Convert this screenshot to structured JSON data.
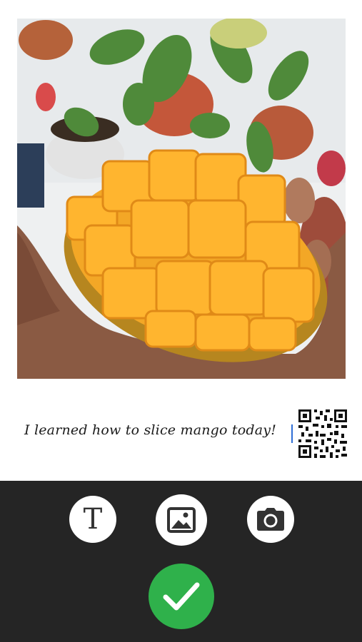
{
  "post": {
    "caption": "I learned how to slice mango today!",
    "photo_icon": "mango-photo",
    "qr_icon": "qr-code-icon"
  },
  "toolbar": {
    "text_tool_icon": "text-tool-icon",
    "text_tool_glyph": "T",
    "image_tool_icon": "image-tool-icon",
    "camera_tool_icon": "camera-tool-icon",
    "confirm_icon": "checkmark-icon"
  },
  "colors": {
    "toolbar_background": "#252525",
    "confirm_green": "#2fb14b",
    "caret_blue": "#2f6fd6"
  }
}
